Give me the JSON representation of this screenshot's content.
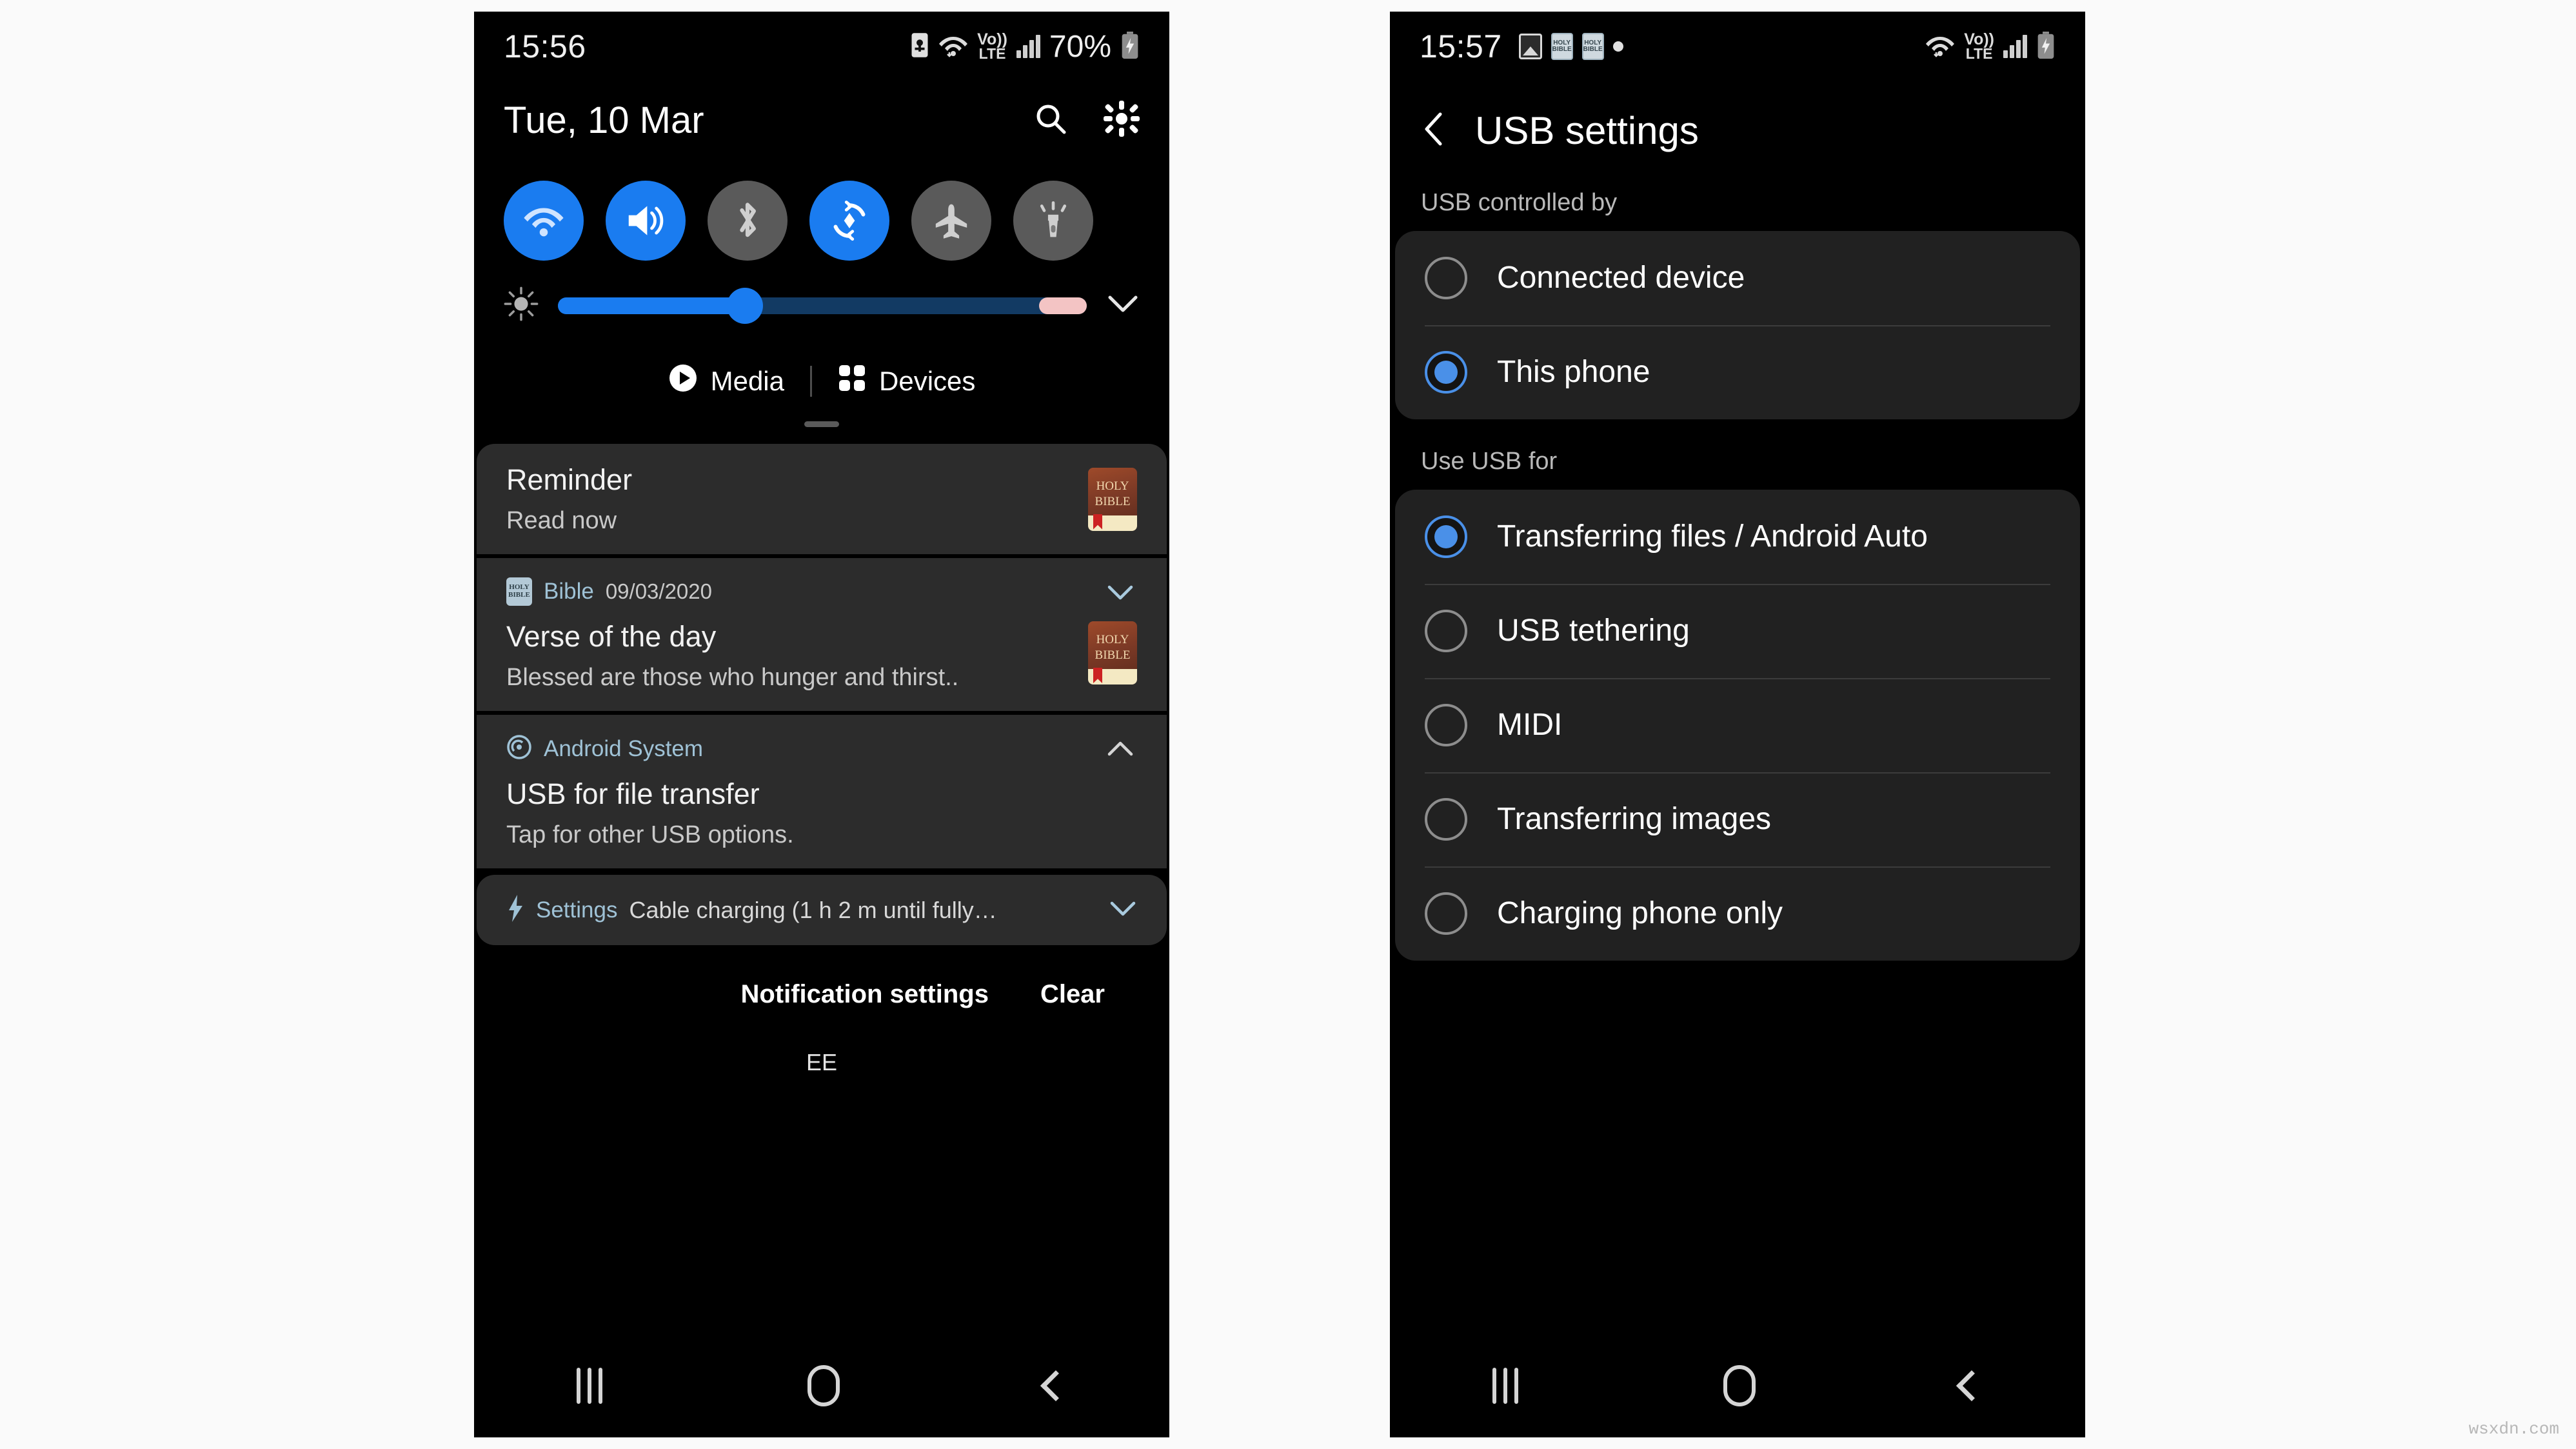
{
  "left_phone": {
    "status_bar": {
      "time": "15:56",
      "battery_percent": "70%",
      "network_label_top": "Vo))",
      "network_label_bottom": "LTE",
      "icons": [
        "sim-card-icon",
        "wifi-icon",
        "volte-icon",
        "signal-bars-icon",
        "battery-charging-icon"
      ]
    },
    "quick_panel": {
      "date": "Tue, 10 Mar",
      "search_icon": "search-icon",
      "settings_icon": "gear-icon",
      "tiles": [
        {
          "name": "wifi-tile",
          "icon": "wifi-icon",
          "state": "on"
        },
        {
          "name": "sound-tile",
          "icon": "volume-icon",
          "state": "on"
        },
        {
          "name": "bluetooth-tile",
          "icon": "bluetooth-icon",
          "state": "off"
        },
        {
          "name": "auto-rotate-tile",
          "icon": "rotate-icon",
          "state": "on"
        },
        {
          "name": "flight-mode-tile",
          "icon": "airplane-icon",
          "state": "off"
        },
        {
          "name": "flashlight-tile",
          "icon": "flashlight-icon",
          "state": "off"
        }
      ],
      "brightness": {
        "icon": "brightness-icon",
        "value_percent": 36,
        "expand_icon": "chevron-down-icon"
      },
      "media_label": "Media",
      "devices_label": "Devices",
      "media_icon": "play-circle-icon",
      "devices_icon": "grid-icon"
    },
    "notifications": [
      {
        "app": "",
        "time": "",
        "title": "Reminder",
        "body": "Read now",
        "thumb": "HOLY BIBLE",
        "thumb_line1": "HOLY",
        "thumb_line2": "BIBLE"
      },
      {
        "app": "Bible",
        "time": "09/03/2020",
        "title": "Verse of the day",
        "body": "Blessed are those who hunger and thirst..",
        "thumb_line1": "HOLY",
        "thumb_line2": "BIBLE",
        "chevron": "chevron-down-icon"
      },
      {
        "app": "Android System",
        "time": "",
        "title": "USB for file transfer",
        "body": "Tap for other USB options.",
        "chevron": "chevron-up-icon"
      }
    ],
    "compact_notification": {
      "icon": "bolt-icon",
      "app": "Settings",
      "text": "Cable charging (1 h 2 m until fully…",
      "chevron": "chevron-down-icon"
    },
    "actions": {
      "notification_settings": "Notification settings",
      "clear": "Clear"
    },
    "carrier": "EE",
    "nav": {
      "recent": "recents-button",
      "home": "home-button",
      "back": "back-button"
    }
  },
  "right_phone": {
    "status_bar": {
      "time": "15:57",
      "network_label_top": "Vo))",
      "network_label_bottom": "LTE",
      "icons": [
        "image-icon",
        "bible-icon",
        "bible-icon",
        "dot-icon",
        "wifi-icon",
        "volte-icon",
        "signal-bars-icon",
        "battery-charging-icon"
      ]
    },
    "header": {
      "back_icon": "chevron-left-icon",
      "title": "USB settings"
    },
    "sections": [
      {
        "label": "USB controlled by",
        "options": [
          {
            "label": "Connected device",
            "selected": false
          },
          {
            "label": "This phone",
            "selected": true
          }
        ]
      },
      {
        "label": "Use USB for",
        "options": [
          {
            "label": "Transferring files / Android Auto",
            "selected": true
          },
          {
            "label": "USB tethering",
            "selected": false
          },
          {
            "label": "MIDI",
            "selected": false
          },
          {
            "label": "Transferring images",
            "selected": false
          },
          {
            "label": "Charging phone only",
            "selected": false
          }
        ]
      }
    ],
    "nav": {
      "recent": "recents-button",
      "home": "home-button",
      "back": "back-button"
    }
  },
  "watermark": "wsxdn.com",
  "colors": {
    "accent_blue": "#1a7cf0",
    "radio_blue": "#4a90e8",
    "card_dark": "#212121",
    "notif_card": "#2c2c2c"
  }
}
